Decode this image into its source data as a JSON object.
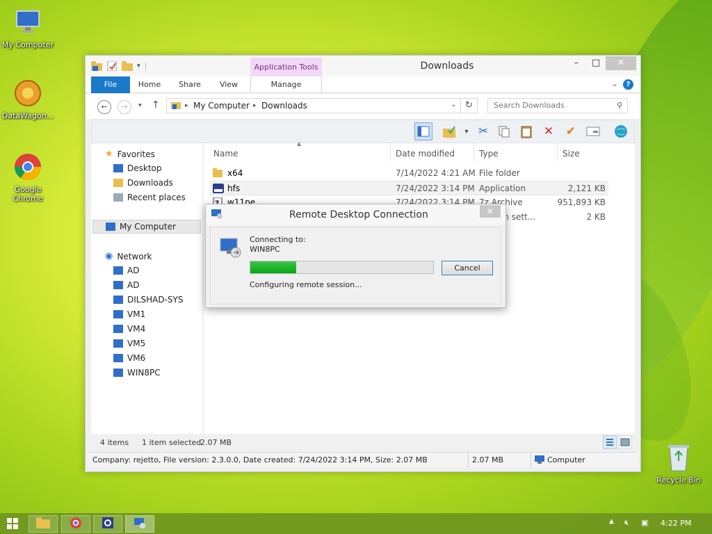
{
  "desktop": {
    "icons": [
      {
        "label": "My Computer"
      },
      {
        "label": "DataWagon..."
      },
      {
        "label": "Google Chrome"
      },
      {
        "label": "Recycle Bin"
      }
    ]
  },
  "explorer": {
    "title": "Downloads",
    "context_tab": "Application Tools",
    "ribbon_tabs": [
      "File",
      "Home",
      "Share",
      "View",
      "Manage"
    ],
    "breadcrumb": [
      "My Computer",
      "Downloads"
    ],
    "search_placeholder": "Search Downloads",
    "nav": {
      "favorites": "Favorites",
      "favorites_items": [
        "Desktop",
        "Downloads",
        "Recent places"
      ],
      "computer": "My Computer",
      "network": "Network",
      "network_items": [
        "AD",
        "AD",
        "DILSHAD-SYS",
        "VM1",
        "VM4",
        "VM5",
        "VM6",
        "WIN8PC"
      ]
    },
    "columns": [
      "Name",
      "Date modified",
      "Type",
      "Size"
    ],
    "files": [
      {
        "name": "x64",
        "date": "7/14/2022 4:21 AM",
        "type": "File folder",
        "size": ""
      },
      {
        "name": "hfs",
        "date": "7/24/2022 3:14 PM",
        "type": "Application",
        "size": "2,121 KB"
      },
      {
        "name": "w11pe",
        "date": "7/24/2022 3:14 PM",
        "type": "7z Archive",
        "size": "951,893 KB"
      },
      {
        "name": "",
        "date": "",
        "type": "uration sett...",
        "size": "2 KB"
      }
    ],
    "status": {
      "items": "4 items",
      "selected": "1 item selected",
      "size": "2.07 MB"
    },
    "details": {
      "info": "Company: rejetto, File version: 2.3.0.0, Date created: 7/24/2022 3:14 PM, Size: 2.07 MB",
      "size": "2.07 MB",
      "location": "Computer"
    }
  },
  "rdc": {
    "title": "Remote Desktop Connection",
    "connecting_label": "Connecting to:",
    "host": "WIN8PC",
    "progress": 0.25,
    "status": "Configuring remote session...",
    "cancel_label": "Cancel"
  },
  "taskbar": {
    "clock": "4:22 PM"
  }
}
